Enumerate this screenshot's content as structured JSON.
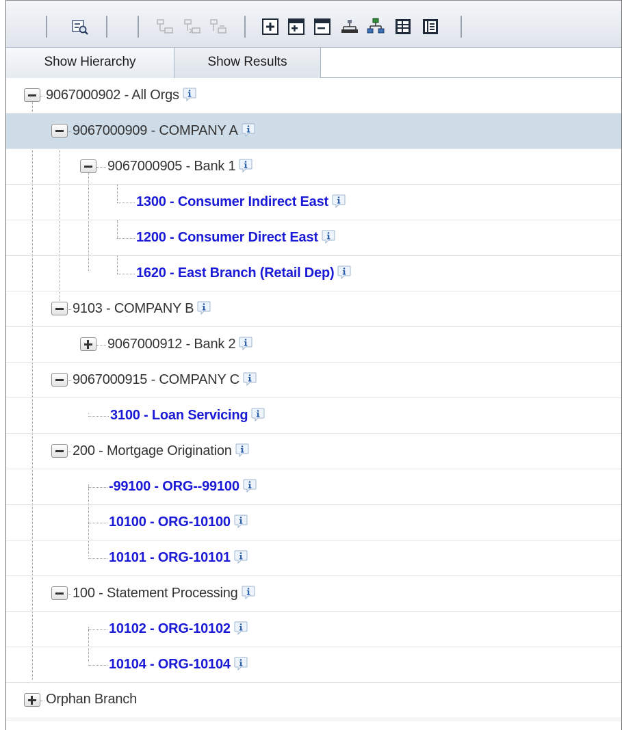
{
  "toolbar": {
    "buttons": [
      {
        "icon": "search-hierarchy-icon",
        "enabled": true
      },
      {
        "icon": "insert-node-icon",
        "enabled": false
      },
      {
        "icon": "move-node-icon",
        "enabled": false
      },
      {
        "icon": "remove-node-icon",
        "enabled": false
      },
      {
        "icon": "expand-all-icon",
        "enabled": true
      },
      {
        "icon": "expand-level-icon",
        "enabled": true
      },
      {
        "icon": "collapse-level-icon",
        "enabled": true
      },
      {
        "icon": "hierarchy-view-icon",
        "enabled": true
      },
      {
        "icon": "org-chart-icon",
        "enabled": true
      },
      {
        "icon": "grid-view-icon",
        "enabled": true
      },
      {
        "icon": "details-view-icon",
        "enabled": true
      }
    ]
  },
  "tabs": [
    {
      "label": "Show Hierarchy",
      "active": true
    },
    {
      "label": "Show Results",
      "active": false
    }
  ],
  "tree": {
    "nodes": [
      {
        "label": "9067000902 - All Orgs",
        "style": "gray",
        "expander": "minus",
        "info": true
      },
      {
        "label": "9067000909 - COMPANY A",
        "style": "gray",
        "expander": "minus",
        "info": true,
        "selected": true
      },
      {
        "label": "9067000905 - Bank 1",
        "style": "gray",
        "expander": "minus",
        "info": true
      },
      {
        "label": "1300 - Consumer Indirect East",
        "style": "blue",
        "expander": "none",
        "info": true
      },
      {
        "label": "1200 - Consumer Direct East",
        "style": "blue",
        "expander": "none",
        "info": true
      },
      {
        "label": "1620 - East Branch  (Retail Dep)",
        "style": "blue",
        "expander": "none",
        "info": true
      },
      {
        "label": "9103 - COMPANY B",
        "style": "gray",
        "expander": "minus",
        "info": true
      },
      {
        "label": "9067000912 - Bank 2",
        "style": "gray",
        "expander": "plus",
        "info": true
      },
      {
        "label": "9067000915 - COMPANY C",
        "style": "gray",
        "expander": "minus",
        "info": true
      },
      {
        "label": "3100 - Loan Servicing",
        "style": "blue",
        "expander": "none",
        "info": true
      },
      {
        "label": "200 - Mortgage Origination",
        "style": "gray",
        "expander": "minus",
        "info": true
      },
      {
        "label": "-99100 - ORG--99100",
        "style": "blue",
        "expander": "none",
        "info": true
      },
      {
        "label": "10100 - ORG-10100",
        "style": "blue",
        "expander": "none",
        "info": true
      },
      {
        "label": "10101 - ORG-10101",
        "style": "blue",
        "expander": "none",
        "info": true
      },
      {
        "label": "100 - Statement Processing",
        "style": "gray",
        "expander": "minus",
        "info": true
      },
      {
        "label": "10102 - ORG-10102",
        "style": "blue",
        "expander": "none",
        "info": true
      },
      {
        "label": "10104 - ORG-10104",
        "style": "blue",
        "expander": "none",
        "info": true
      },
      {
        "label": "Orphan Branch",
        "style": "gray",
        "expander": "plus",
        "info": false
      }
    ]
  },
  "colors": {
    "leaf_text": "#1a1ad6",
    "branch_text": "#333333",
    "selected_row": "#cfdde9"
  }
}
